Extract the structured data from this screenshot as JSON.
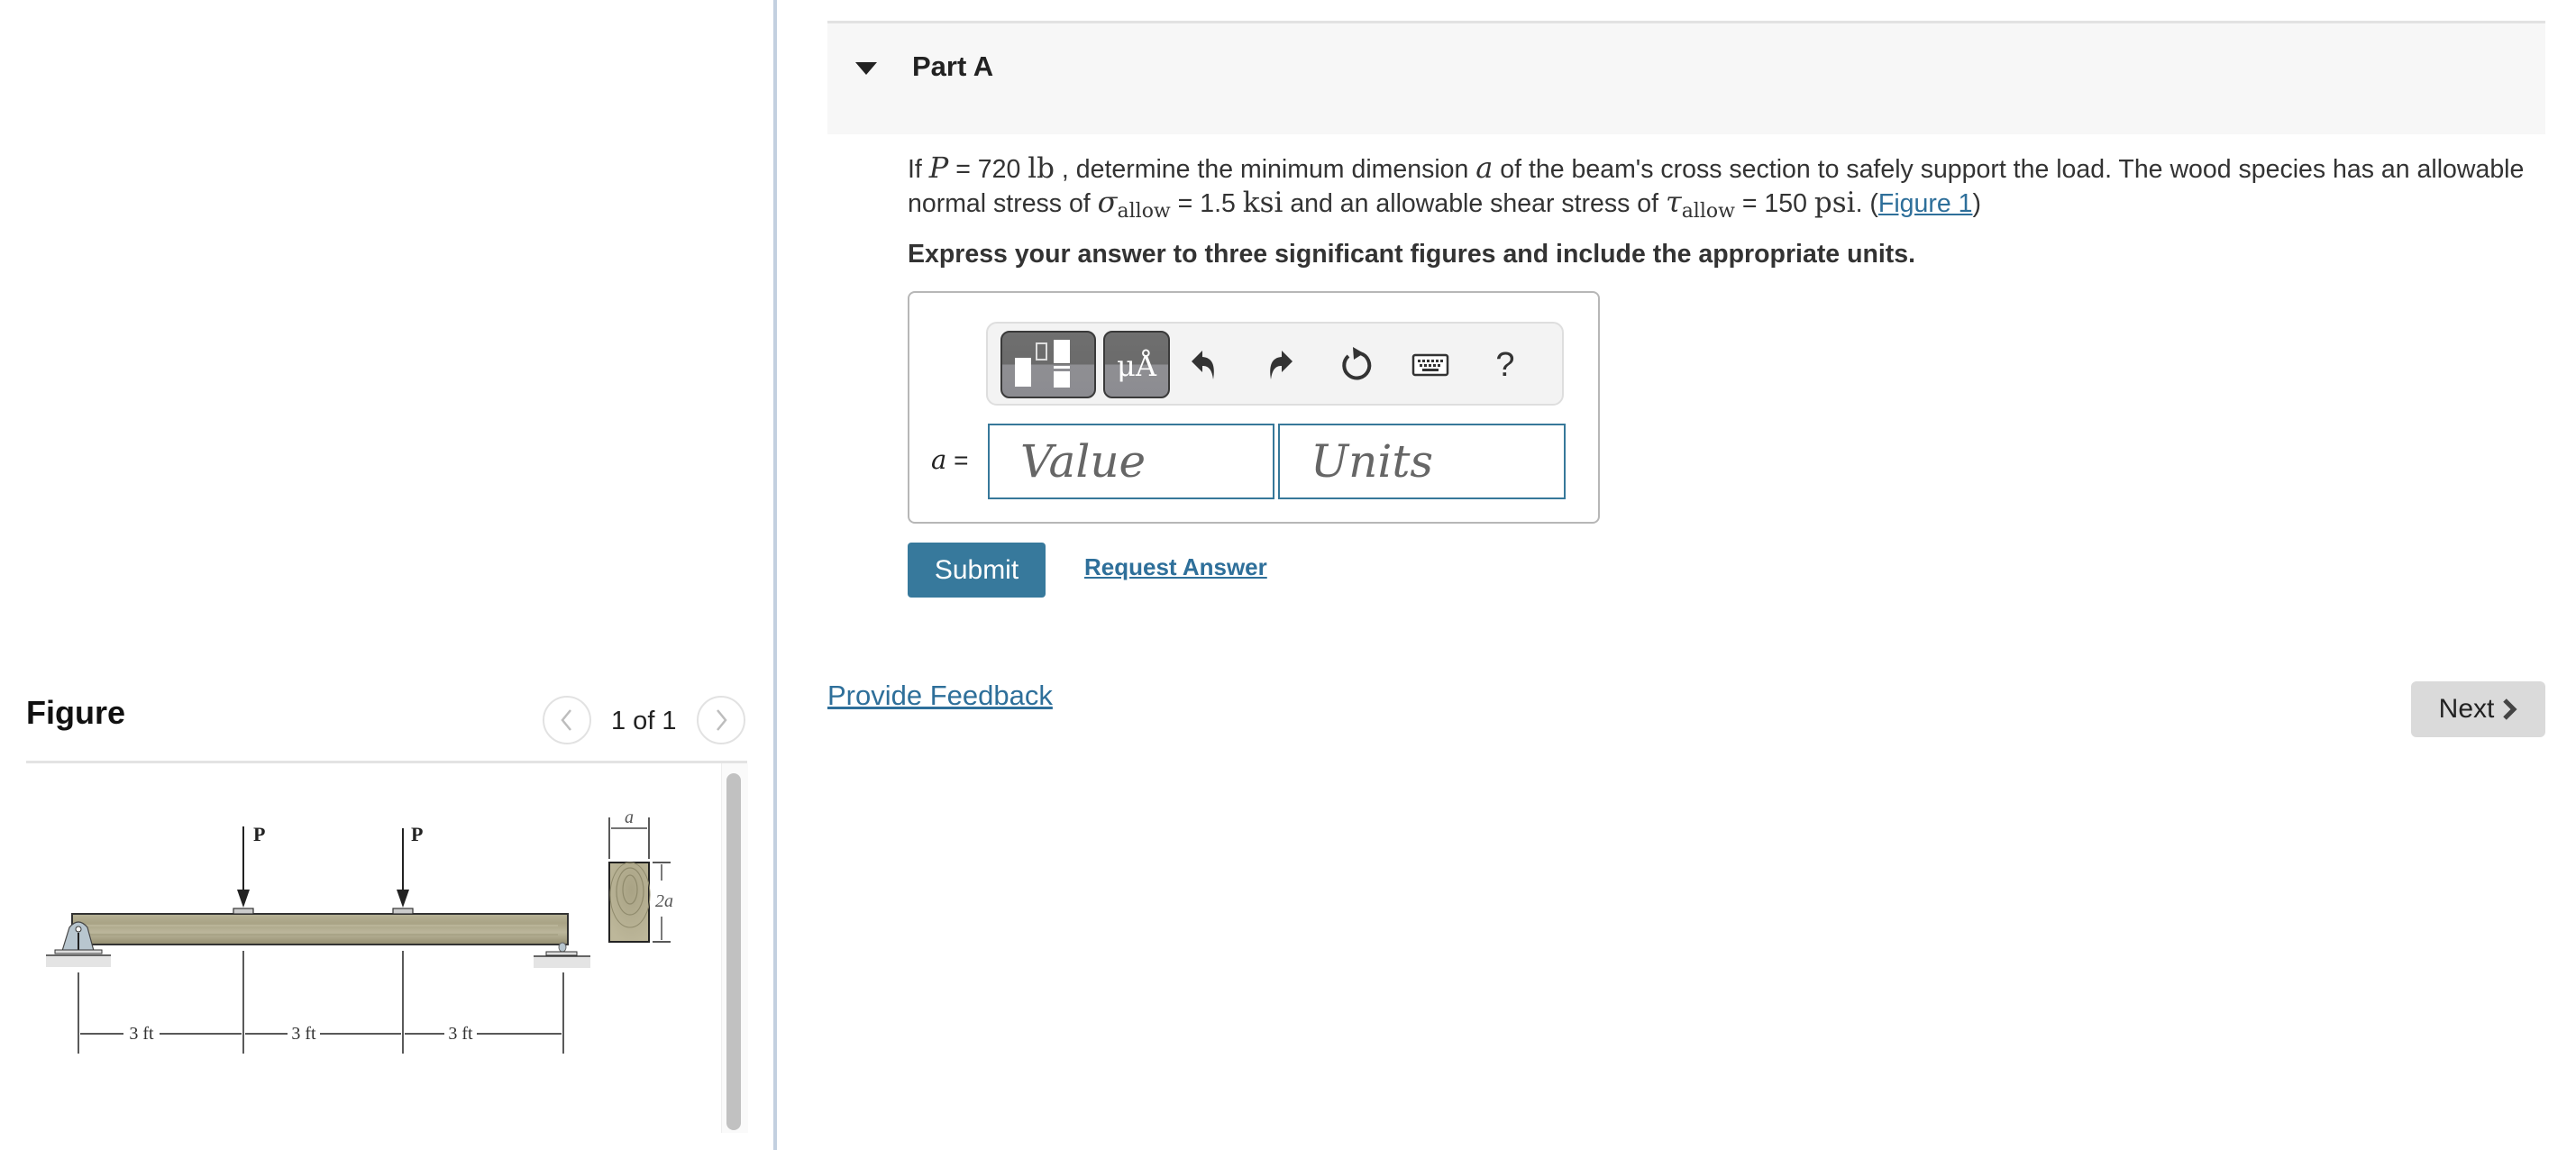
{
  "figure_panel": {
    "title": "Figure",
    "counter": "1 of 1",
    "prev_icon": "chevron-left-icon",
    "next_icon": "chevron-right-icon",
    "diagram": {
      "load_label_1": "P",
      "load_label_2": "P",
      "dim_1": "3 ft",
      "dim_2": "3 ft",
      "dim_3": "3 ft",
      "section_width": "a",
      "section_height": "2a"
    }
  },
  "part": {
    "title": "Part A",
    "toggle_icon": "caret-down-icon",
    "question": {
      "t1": "If ",
      "P": "P",
      "t2": " = 720 ",
      "lb": "lb",
      "t3": " , determine the minimum dimension ",
      "a": "a",
      "t4": " of the beam's cross section to safely support the load. The wood species has an allowable normal stress of ",
      "sigma": "σ",
      "sub1": "allow",
      "t5": " = 1.5 ",
      "ksi": "ksi",
      "t6": " and an allowable shear stress of ",
      "tau": "τ",
      "sub2": "allow",
      "t7": " = 150 ",
      "psi": "psi",
      "t8": ". (",
      "figure_link": "Figure 1",
      "t9": ")"
    },
    "instruction": "Express your answer to three significant figures and include the appropriate units.",
    "toolbar": {
      "templates_icon": "templates-icon",
      "symbols_label": "μÅ",
      "undo_icon": "undo-icon",
      "redo_icon": "redo-icon",
      "reset_icon": "reset-icon",
      "keyboard_icon": "keyboard-icon",
      "help_label": "?"
    },
    "answer": {
      "variable": "a",
      "equals": " =",
      "value": "",
      "value_placeholder": "Value",
      "units": "",
      "units_placeholder": "Units"
    },
    "submit_label": "Submit",
    "request_answer_label": "Request Answer"
  },
  "footer": {
    "feedback_label": "Provide Feedback",
    "next_label": "Next"
  },
  "colors": {
    "accent": "#37799c",
    "link": "#2e6f9a",
    "divider": "#c3d0e0"
  }
}
